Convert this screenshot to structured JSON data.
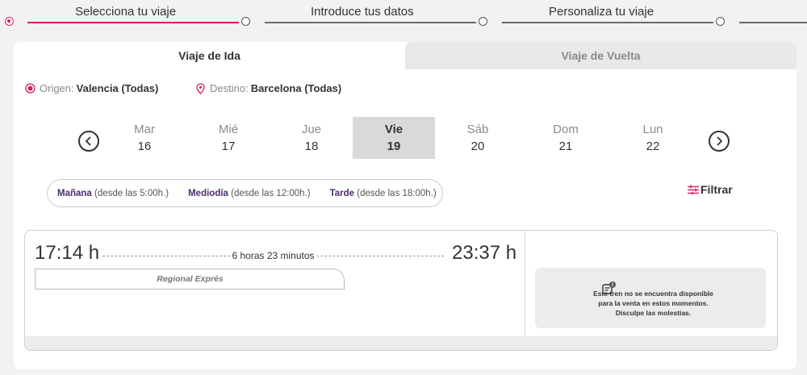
{
  "steps": [
    {
      "label": "Selecciona tu viaje",
      "active": true
    },
    {
      "label": "Introduce tus datos",
      "active": false
    },
    {
      "label": "Personaliza tu viaje",
      "active": false
    }
  ],
  "tabs": {
    "ida": "Viaje de Ida",
    "vuelta": "Viaje de Vuelta"
  },
  "route": {
    "origin_label": "Origen:",
    "origin_city": "Valencia",
    "origin_scope": "(Todas)",
    "destination_label": "Destino:",
    "destination_city": "Barcelona",
    "destination_scope": "(Todas)"
  },
  "days": [
    {
      "name": "Mar",
      "num": "16"
    },
    {
      "name": "Mié",
      "num": "17"
    },
    {
      "name": "Jue",
      "num": "18"
    },
    {
      "name": "Vie",
      "num": "19",
      "selected": true
    },
    {
      "name": "Sáb",
      "num": "20"
    },
    {
      "name": "Dom",
      "num": "21"
    },
    {
      "name": "Lun",
      "num": "22"
    }
  ],
  "filters": {
    "manana_bold": "Mañana",
    "manana_rest": "(desde las 5:00h.)",
    "mediodia_bold": "Mediodía",
    "mediodia_rest": "(desde las 12:00h.)",
    "tarde_bold": "Tarde",
    "tarde_rest": "(desde las 18:00h.)",
    "filtrar_label": "Filtrar"
  },
  "train": {
    "departure": "17:14 h",
    "arrival": "23:37 h",
    "duration": "6 horas 23 minutos",
    "service": "Regional Exprés",
    "unavailable_msg": "Este tren no se encuentra disponible para la venta en estos momentos. Disculpe las molestias."
  },
  "colors": {
    "accent": "#d81e5b",
    "purple": "#4b2c6e"
  },
  "icons": {
    "step": "radio-dot-icon",
    "origin": "origin-dot-icon",
    "destination": "location-pin-icon",
    "prev": "chevron-left-icon",
    "next": "chevron-right-icon",
    "filter": "sliders-icon",
    "unavailable": "ticket-alert-icon"
  }
}
